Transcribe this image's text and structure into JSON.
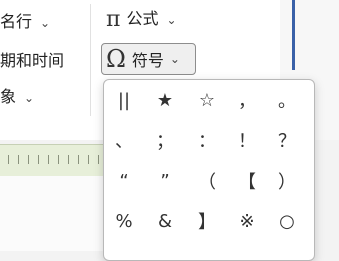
{
  "ribbon": {
    "item_name_row": "名行",
    "item_date_time": "期和时间",
    "item_object": "象",
    "formula_label": "公式",
    "formula_icon_glyph": "π",
    "symbol_label": "符号",
    "symbol_icon_glyph": "Ω",
    "chevron": "⌄"
  },
  "symbol_panel": {
    "rows": [
      [
        "||",
        "★",
        "☆",
        "，",
        "。"
      ],
      [
        "、",
        "；",
        "：",
        "！",
        "？"
      ],
      [
        "“",
        "”",
        "（",
        "【",
        "）"
      ],
      [
        "%",
        "&",
        "】",
        "※",
        "○"
      ]
    ]
  },
  "colors": {
    "panel_bg": "#ffffff",
    "ruler_bg": "#e7efd9",
    "accent": "#3a61a8"
  }
}
